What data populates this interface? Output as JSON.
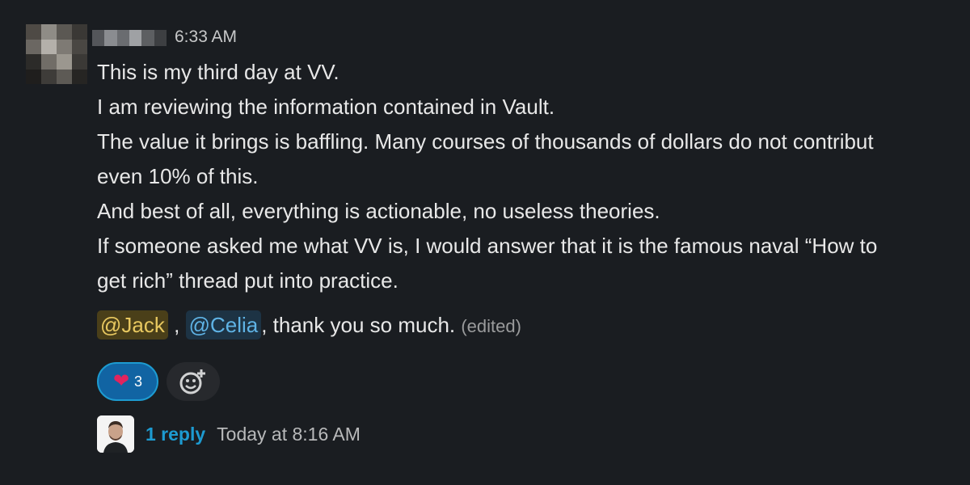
{
  "message": {
    "timestamp": "6:33 AM",
    "lines": [
      "This is my third day at VV.",
      "I am reviewing the information contained in Vault.",
      "The value it brings is baffling. Many courses of thousands of dollars do not contribut",
      "even 10% of this.",
      "And best of all, everything is actionable, no useless theories."
    ],
    "paragraph2": [
      "If someone asked me what VV is, I would answer that it is the famous naval “How to",
      "get rich” thread put into practice."
    ],
    "mention1": "@Jack",
    "separator": ",",
    "mention2": "@Celia",
    "closing": ", thank you so much.",
    "edited": "(edited)"
  },
  "reactions": {
    "heart_count": "3",
    "heart_icon": "heart-icon",
    "add_icon": "add-reaction-icon"
  },
  "thread": {
    "reply_count": "1 reply",
    "last_reply": "Today at 8:16 AM"
  },
  "colors": {
    "background": "#1a1d21",
    "link": "#1d9bd1",
    "reaction_bg": "#1164a3",
    "mention_jack": "#e8c860",
    "mention_celia": "#5fb3e5"
  }
}
